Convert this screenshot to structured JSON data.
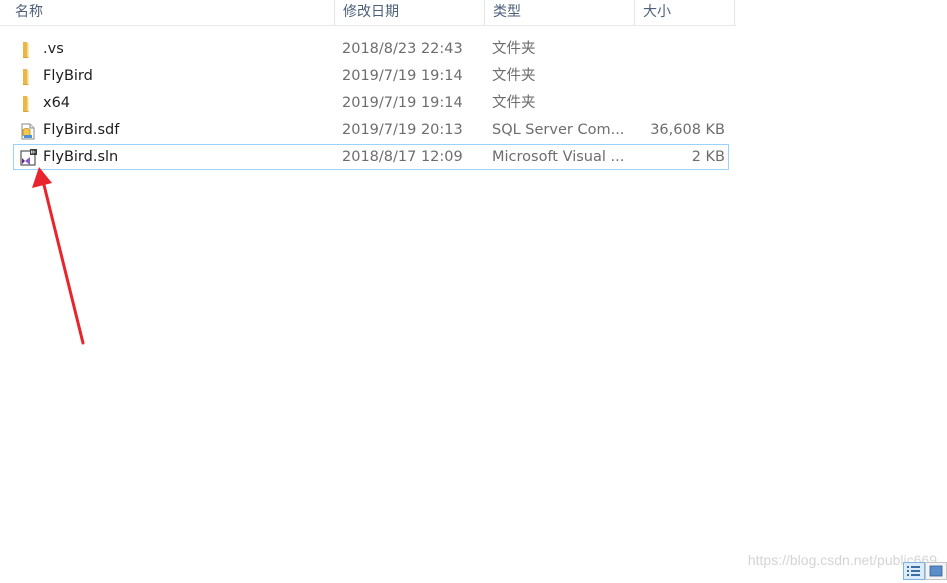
{
  "columns": {
    "name": "名称",
    "date": "修改日期",
    "type": "类型",
    "size": "大小"
  },
  "files": [
    {
      "name": ".vs",
      "date": "2018/8/23 22:43",
      "type": "文件夹",
      "size": "",
      "icon": "folder-icon"
    },
    {
      "name": "FlyBird",
      "date": "2019/7/19 19:14",
      "type": "文件夹",
      "size": "",
      "icon": "folder-icon"
    },
    {
      "name": "x64",
      "date": "2019/7/19 19:14",
      "type": "文件夹",
      "size": "",
      "icon": "folder-icon"
    },
    {
      "name": "FlyBird.sdf",
      "date": "2019/7/19 20:13",
      "type": "SQL Server Com...",
      "size": "36,608 KB",
      "icon": "sql-database-icon"
    },
    {
      "name": "FlyBird.sln",
      "date": "2018/8/17 12:09",
      "type": "Microsoft Visual ...",
      "size": "2 KB",
      "icon": "visual-studio-solution-icon"
    }
  ],
  "watermark": "https://blog.csdn.net/public669",
  "colors": {
    "selection_border": "#99d1ff",
    "arrow": "#e8252c",
    "folder": "#f8d775"
  }
}
